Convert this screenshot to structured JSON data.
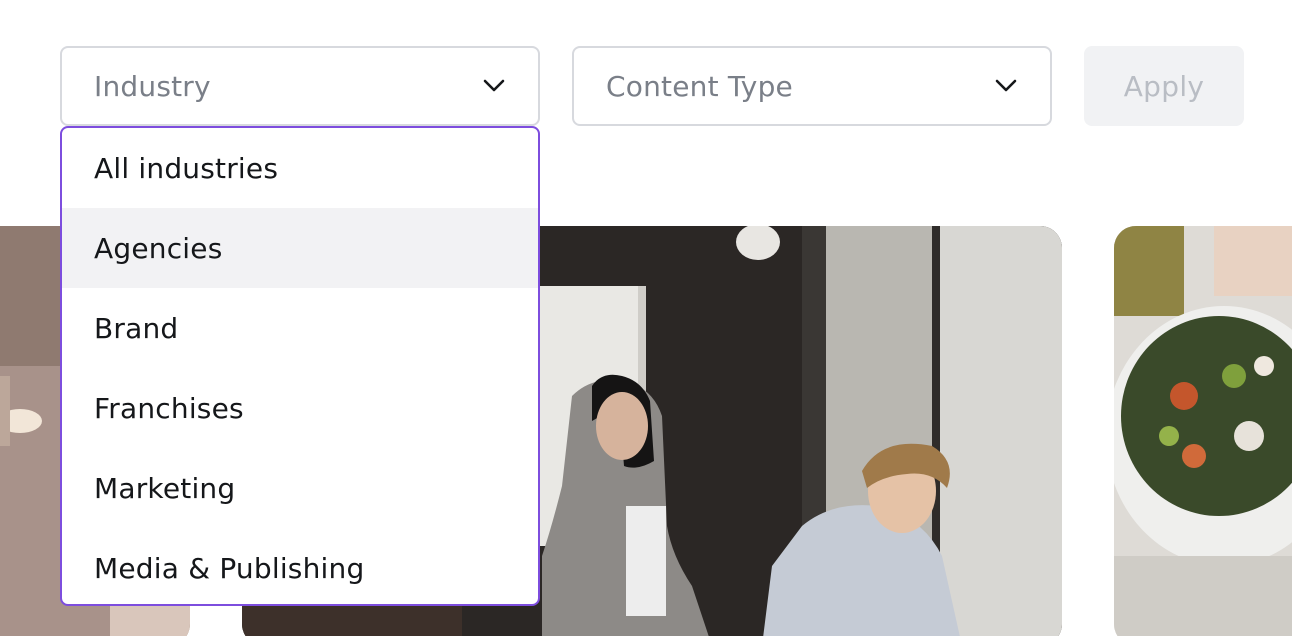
{
  "filters": {
    "industry": {
      "placeholder": "Industry",
      "open": true,
      "options": [
        "All industries",
        "Agencies",
        "Brand",
        "Franchises",
        "Marketing",
        "Media & Publishing"
      ],
      "highlighted_option": "Agencies"
    },
    "content_type": {
      "placeholder": "Content Type"
    },
    "apply_label": "Apply"
  },
  "colors": {
    "dropdown_border": "#7d4dde",
    "highlight_row": "#f2f2f4",
    "apply_bg": "#f1f2f4",
    "apply_text": "#b9bdc4"
  },
  "icons": {
    "select_chevron": "chevron-down-icon"
  }
}
